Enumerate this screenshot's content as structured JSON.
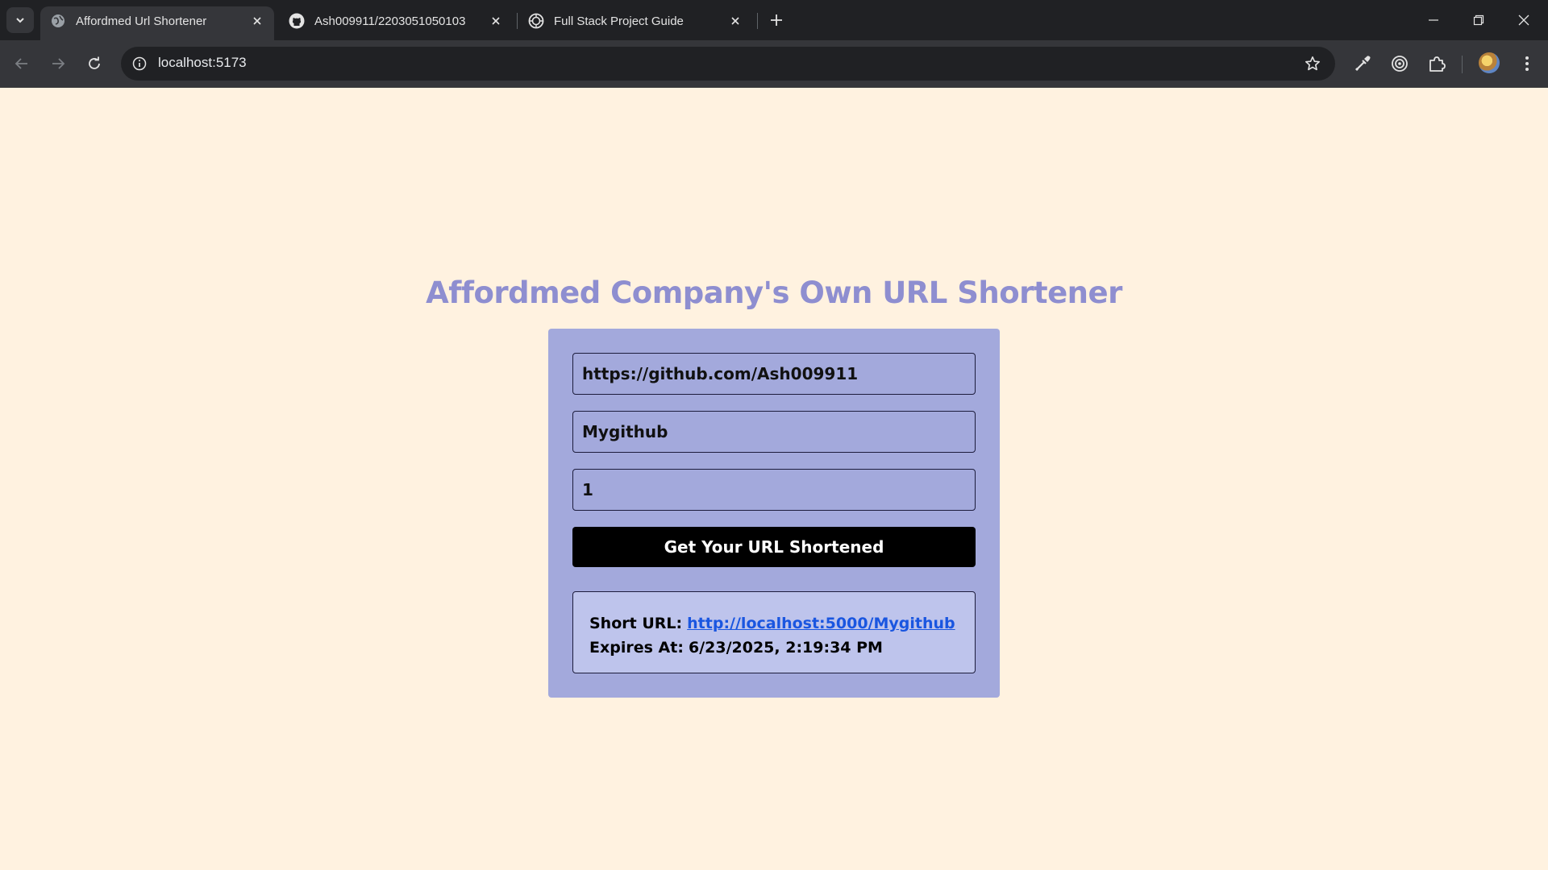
{
  "browser": {
    "tabs": [
      {
        "title": "Affordmed Url Shortener",
        "favicon": "globe-icon",
        "active": true
      },
      {
        "title": "Ash009911/2203051050103",
        "favicon": "github-icon",
        "active": false
      },
      {
        "title": "Full Stack Project Guide",
        "favicon": "openai-icon",
        "active": false
      }
    ],
    "address": "localhost:5173"
  },
  "page": {
    "title": "Affordmed Company's Own URL Shortener",
    "form": {
      "url_value": "https://github.com/Ash009911",
      "code_value": "Mygithub",
      "validity_value": "1",
      "submit_label": "Get Your URL Shortened"
    },
    "result": {
      "short_url_label": "Short URL:",
      "short_url": "http://localhost:5000/Mygithub",
      "expires_label": "Expires At:",
      "expires_value": "6/23/2025, 2:19:34 PM"
    }
  },
  "colors": {
    "page_bg": "#fff2e0",
    "title": "#8e8ed0",
    "card_bg": "#a3a9dc",
    "result_bg": "#bec4ec",
    "button_bg": "#000000",
    "link": "#1a56e0"
  }
}
